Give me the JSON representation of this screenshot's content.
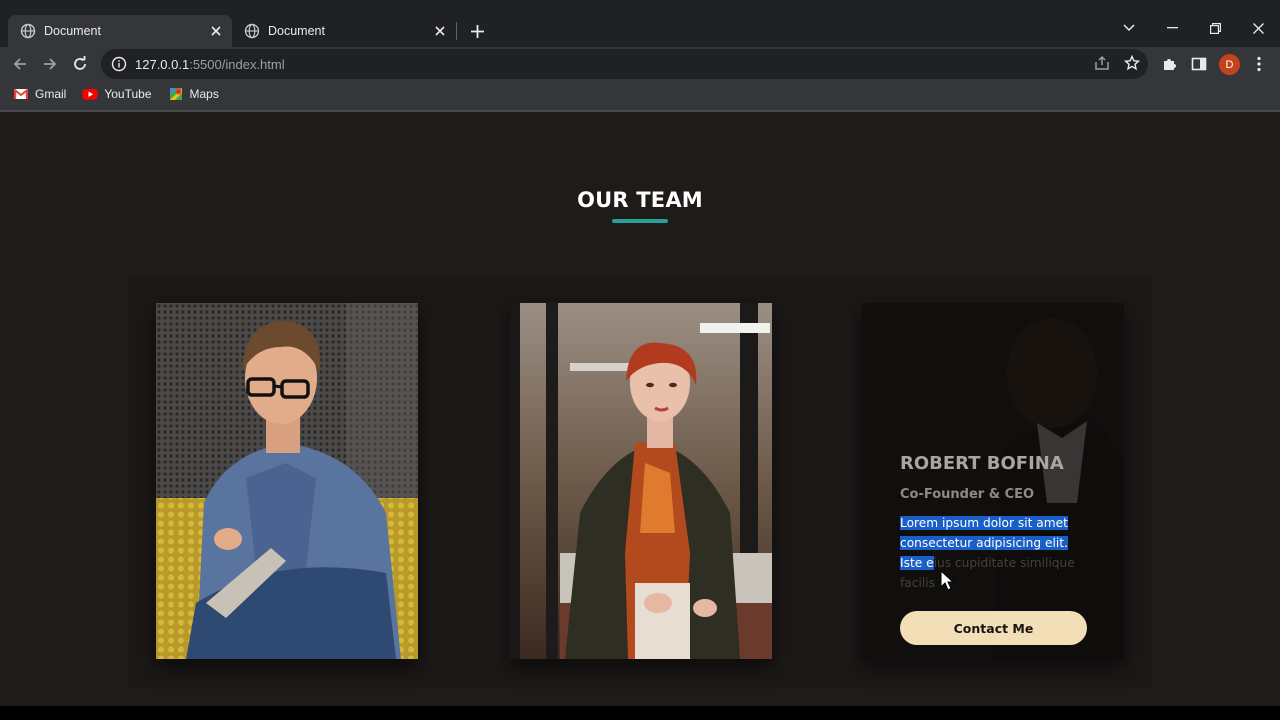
{
  "browser": {
    "tabs": [
      {
        "title": "Document",
        "active": true
      },
      {
        "title": "Document",
        "active": false
      }
    ],
    "url_host": "127.0.0.1",
    "url_path": ":5500/index.html",
    "profile_initial": "D",
    "bookmarks": [
      {
        "label": "Gmail",
        "icon": "gmail-icon"
      },
      {
        "label": "YouTube",
        "icon": "youtube-icon"
      },
      {
        "label": "Maps",
        "icon": "maps-icon"
      }
    ]
  },
  "section": {
    "title": "OUR TEAM",
    "accent_color": "#2aa198"
  },
  "team": [
    {
      "photo": "man-writing-notebook-photo"
    },
    {
      "photo": "woman-office-photo"
    },
    {
      "photo": "man-suit-photo",
      "name": "ROBERT BOFINA",
      "role": "Co-Founder & CEO",
      "desc_selected": "Lorem ipsum dolor sit amet consectetur adipisicing elit. Iste e",
      "desc_rest": "ius cupiditate similique facilis",
      "button": "Contact Me"
    }
  ]
}
